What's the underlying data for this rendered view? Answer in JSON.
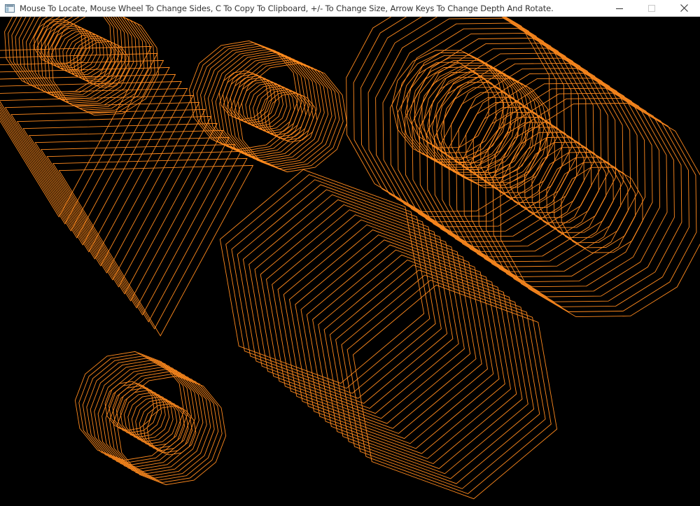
{
  "window": {
    "title": "Mouse To Locate, Mouse Wheel To Change Sides, C To Copy To Clipboard, +/- To Change Size, Arrow Keys To Change Depth And Rotate.",
    "app_icon": "window-app-icon",
    "controls": {
      "minimize_icon": "minimize-icon",
      "maximize_icon": "maximize-icon",
      "close_icon": "close-icon"
    }
  },
  "canvas": {
    "background": "#000000",
    "stroke_color": "#ff8a1e"
  }
}
